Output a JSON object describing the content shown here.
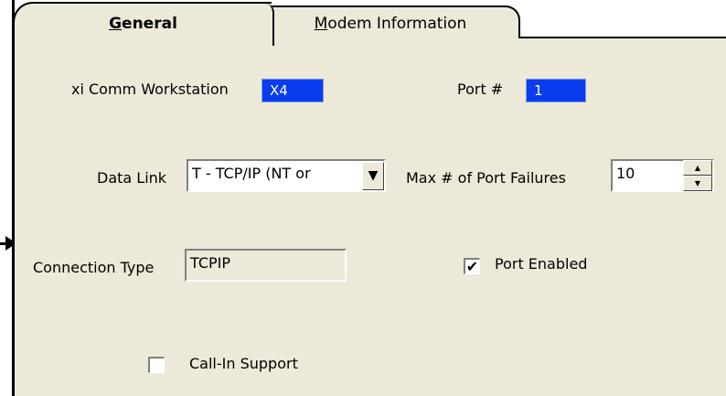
{
  "tabs": [
    {
      "label_prefix": "",
      "label_hotkey": "G",
      "label_rest": "eneral"
    },
    {
      "label_prefix": "",
      "label_hotkey": "M",
      "label_rest": "odem Information"
    }
  ],
  "form": {
    "workstation": {
      "label": "xi Comm Workstation",
      "value": "X4"
    },
    "port": {
      "label": "Port #",
      "value": "1"
    },
    "data_link": {
      "label": "Data Link",
      "value": "T - TCP/IP (NT or",
      "arrow": "▼"
    },
    "max_failures": {
      "label": "Max # of Port Failures",
      "value": "10",
      "up": "▲",
      "down": "▼"
    },
    "connection_type": {
      "label": "Connection Type",
      "value": "TCPIP"
    },
    "port_enabled": {
      "label": "Port Enabled",
      "checked_glyph": "✔"
    },
    "call_in": {
      "label": "Call-In Support",
      "checked_glyph": ""
    }
  },
  "colors": {
    "panel_background": "#ece9d8",
    "selected_field": "#0a3cf0"
  }
}
